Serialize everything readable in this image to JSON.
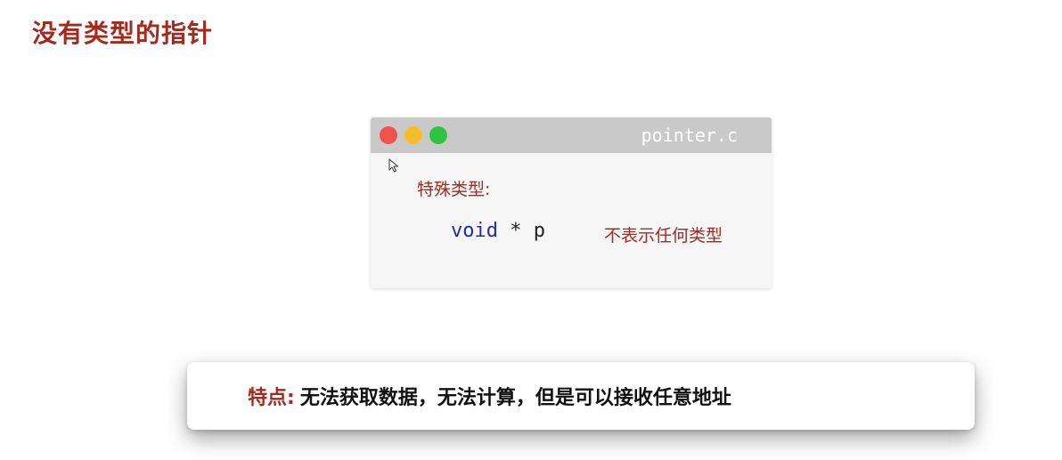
{
  "page": {
    "title": "没有类型的指针"
  },
  "code_window": {
    "filename": "pointer.c",
    "section_label": "特殊类型:",
    "code": {
      "keyword": "void",
      "operator": " * ",
      "identifier": "p"
    },
    "comment": "不表示任何类型"
  },
  "feature": {
    "label": "特点:",
    "text": "无法获取数据，无法计算，但是可以接收任意地址"
  },
  "colors": {
    "accent": "#a52a1e",
    "keyword": "#1f2bb0",
    "titlebar": "#c9c9c9",
    "dot_red": "#f0534b",
    "dot_yellow": "#f5bf2b",
    "dot_green": "#2dc43f"
  },
  "icons": {
    "cursor": "mouse-pointer-icon",
    "window_close": "close-dot-icon",
    "window_minimize": "minimize-dot-icon",
    "window_maximize": "maximize-dot-icon"
  }
}
